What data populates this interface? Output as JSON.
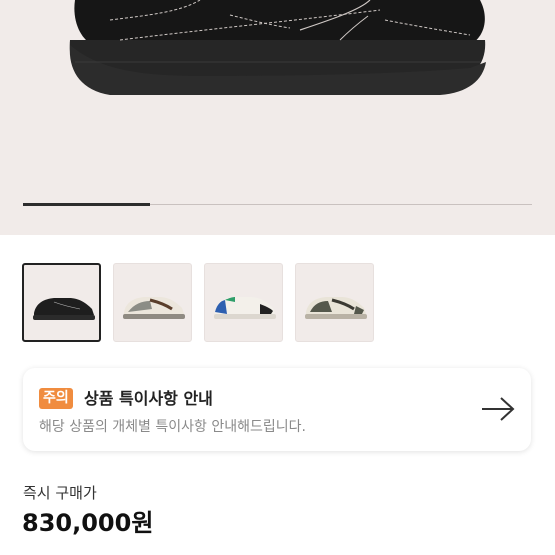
{
  "gallery": {
    "progress": 0.25,
    "thumbnails": [
      {
        "name": "black-sneaker",
        "selected": true
      },
      {
        "name": "sail-brown-sneaker",
        "selected": false
      },
      {
        "name": "blue-accent-sneaker",
        "selected": false
      },
      {
        "name": "olive-sneaker",
        "selected": false
      }
    ]
  },
  "notice": {
    "badge": "주의",
    "title": "상품 특이사항 안내",
    "description": "해당 상품의 개체별 특이사항 안내해드립니다.",
    "arrow_icon": "arrow-right-icon",
    "badge_color": "#f08c3f"
  },
  "purchase": {
    "label": "즉시 구매가",
    "price": "830,000원"
  }
}
